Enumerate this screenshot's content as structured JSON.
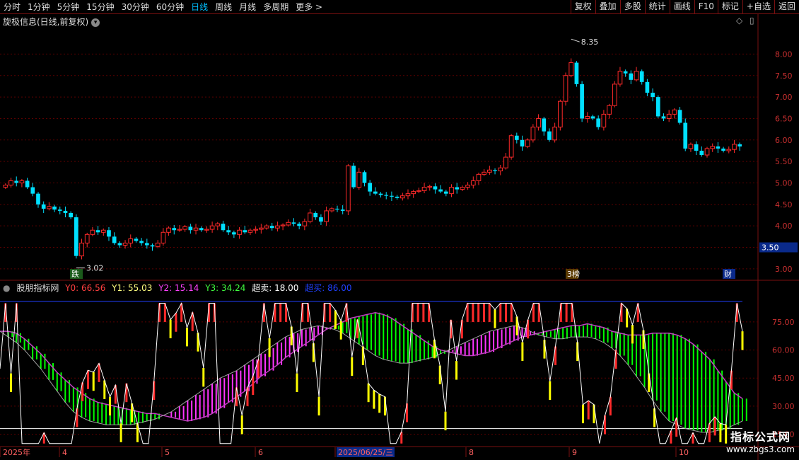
{
  "periods": [
    "分时",
    "1分钟",
    "5分钟",
    "15分钟",
    "30分钟",
    "60分钟",
    "日线",
    "周线",
    "月线",
    "多周期",
    "更多 >"
  ],
  "active_period": "日线",
  "toolbar_buttons": [
    "复权",
    "叠加",
    "多股",
    "统计",
    "画线",
    "F10",
    "标记",
    "+自选",
    "返回"
  ],
  "chart_title": "旋极信息(日线,前复权)",
  "colors": {
    "up": "#ff2a2a",
    "down": "#00e0ff",
    "grid": "#5a0000",
    "axis": "#7a1010",
    "yellow": "#ffff00",
    "green": "#00ff00",
    "magenta": "#ff33ff"
  },
  "chart_data": [
    {
      "type": "candlestick",
      "ylim": [
        2.8,
        8.6
      ],
      "y_ticks": [
        "8.00",
        "7.50",
        "7.00",
        "6.50",
        "6.00",
        "5.50",
        "5.00",
        "4.50",
        "4.00",
        "3.50",
        "3.00"
      ],
      "current_price_label": "3.50",
      "high_marker": "8.35",
      "low_marker": "3.02",
      "event_markers": [
        "跌",
        "3榜",
        "财"
      ],
      "close": [
        4.95,
        5.05,
        5.0,
        5.05,
        4.9,
        4.75,
        4.5,
        4.4,
        4.45,
        4.38,
        4.35,
        4.3,
        4.2,
        3.3,
        3.6,
        3.8,
        3.9,
        3.85,
        3.9,
        3.75,
        3.6,
        3.55,
        3.6,
        3.7,
        3.65,
        3.6,
        3.55,
        3.52,
        3.6,
        3.85,
        3.95,
        3.9,
        3.92,
        3.98,
        3.9,
        3.95,
        3.9,
        3.92,
        4.0,
        4.05,
        3.9,
        3.85,
        3.8,
        3.9,
        3.85,
        3.9,
        3.92,
        3.95,
        4.0,
        3.95,
        4.0,
        4.02,
        4.08,
        4.05,
        4.0,
        4.1,
        4.3,
        4.2,
        4.1,
        4.35,
        4.4,
        4.38,
        4.35,
        5.4,
        4.9,
        5.25,
        5.0,
        4.8,
        4.75,
        4.72,
        4.7,
        4.68,
        4.65,
        4.7,
        4.75,
        4.8,
        4.82,
        4.9,
        4.92,
        4.85,
        4.8,
        4.75,
        4.9,
        4.85,
        4.9,
        4.95,
        5.05,
        5.2,
        5.25,
        5.3,
        5.28,
        5.35,
        5.6,
        6.1,
        6.0,
        5.85,
        6.0,
        6.3,
        6.5,
        6.2,
        6.0,
        6.3,
        6.9,
        7.5,
        7.8,
        7.3,
        6.5,
        6.55,
        6.5,
        6.3,
        6.6,
        6.8,
        7.3,
        7.6,
        7.55,
        7.4,
        7.6,
        7.35,
        7.1,
        7.0,
        6.55,
        6.5,
        6.6,
        6.7,
        6.4,
        5.8,
        5.9,
        5.75,
        5.65,
        5.8,
        5.85,
        5.8,
        5.75,
        5.78,
        5.9,
        5.85
      ],
      "last_value": 5.85
    },
    {
      "type": "indicator",
      "name": "股朋指标网",
      "series_values": {
        "Y0": "66.56",
        "Y1": "55.03",
        "Y2": "15.14",
        "Y3": "34.24",
        "超卖": "18.00",
        "超买": "86.00"
      },
      "ylim": [
        8,
        92
      ],
      "y_ticks": [
        "75.00",
        "60.00",
        "45.00",
        "30.00",
        "15.00"
      ],
      "x_labels": [
        "2025年",
        "4",
        "5",
        "6",
        "2025/06/25/三",
        "8",
        "9",
        "10"
      ],
      "cloud_upper": [
        70,
        70,
        69,
        66,
        62,
        58,
        53,
        48,
        44,
        40,
        37,
        34,
        32,
        31,
        30,
        29,
        28,
        27,
        26,
        26,
        25,
        24,
        23,
        22,
        23,
        24,
        26,
        29,
        32,
        35,
        38,
        42,
        46,
        49,
        52,
        56,
        59,
        62,
        65,
        68,
        71,
        73,
        75,
        77,
        78,
        79,
        80,
        79,
        77,
        74,
        71,
        68,
        65,
        62,
        60,
        59,
        58,
        57,
        57,
        58,
        59,
        61,
        63,
        65,
        67,
        68,
        69,
        70,
        71,
        72,
        73,
        73,
        74,
        73,
        72,
        70,
        69,
        68,
        68,
        68,
        69,
        69,
        69,
        68,
        66,
        63,
        59,
        55,
        49,
        43,
        37,
        34
      ],
      "cloud_lower": [
        70,
        67,
        64,
        60,
        55,
        50,
        44,
        38,
        32,
        27,
        24,
        22,
        21,
        20,
        20,
        20,
        20,
        21,
        22,
        23,
        25,
        27,
        30,
        33,
        36,
        39,
        42,
        45,
        47,
        49,
        52,
        55,
        58,
        61,
        64,
        67,
        69,
        71,
        72,
        73,
        72,
        71,
        69,
        66,
        63,
        60,
        57,
        55,
        54,
        53,
        53,
        54,
        55,
        56,
        58,
        60,
        62,
        64,
        66,
        68,
        70,
        71,
        72,
        73,
        72,
        70,
        68,
        67,
        66,
        66,
        67,
        67,
        67,
        66,
        64,
        61,
        57,
        52,
        46,
        40,
        33,
        27,
        22,
        20,
        18,
        17,
        16,
        16,
        17,
        18,
        20,
        22
      ]
    }
  ],
  "logo": {
    "line1": "指标公式网",
    "line2": "www.zbgs3.com"
  }
}
